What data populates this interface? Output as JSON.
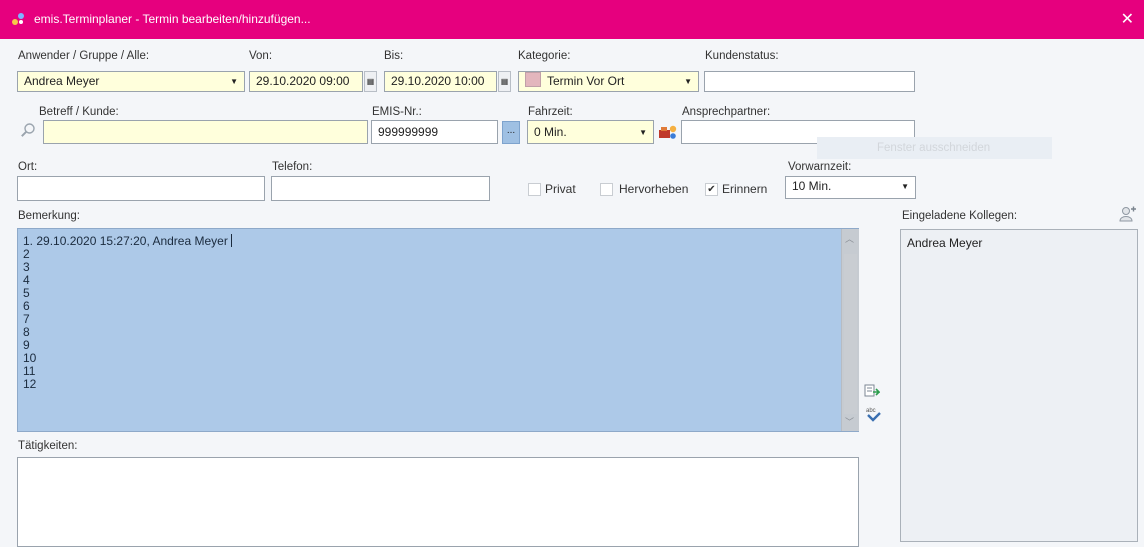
{
  "window": {
    "title": "emis.Terminplaner - Termin bearbeiten/hinzufügen...",
    "close_glyph": "✕",
    "icon": "app-icon",
    "titlebar_color": "#e6007e"
  },
  "row1": {
    "user_label": "Anwender / Gruppe / Alle:",
    "user_value": "Andrea Meyer",
    "from_label": "Von:",
    "from_value": "29.10.2020 09:00",
    "to_label": "Bis:",
    "to_value": "29.10.2020 10:00",
    "category_label": "Kategorie:",
    "category_value": "Termin Vor Ort",
    "category_color": "#e3b6bd",
    "customer_status_label": "Kundenstatus:",
    "customer_status_value": ""
  },
  "row2": {
    "subject_label": "Betreff / Kunde:",
    "subject_value": "",
    "emis_label": "EMIS-Nr.:",
    "emis_value": "999999999",
    "emis_button": "...",
    "travel_label": "Fahrzeit:",
    "travel_value": "0 Min.",
    "contact_label": "Ansprechpartner:",
    "contact_value": ""
  },
  "ghost_button": "Fenster ausschneiden",
  "row3": {
    "place_label": "Ort:",
    "place_value": "",
    "phone_label": "Telefon:",
    "phone_value": "",
    "private_label": "Privat",
    "private_checked": false,
    "highlight_label": "Hervorheben",
    "highlight_checked": false,
    "remind_label": "Erinnern",
    "remind_checked": true,
    "remind_check_glyph": "✔",
    "warning_label": "Vorwarnzeit:",
    "warning_value": "10 Min."
  },
  "remark": {
    "label": "Bemerkung:",
    "lines": [
      "1. 29.10.2020 15:27:20, Andrea Meyer",
      "2",
      "3",
      "4",
      "5",
      "6",
      "7",
      "8",
      "9",
      "10",
      "11",
      "12"
    ],
    "background": "#adc9e8"
  },
  "activities": {
    "label": "Tätigkeiten:",
    "value": ""
  },
  "invited": {
    "label": "Eingeladene Kollegen:",
    "members": [
      "Andrea Meyer"
    ]
  }
}
